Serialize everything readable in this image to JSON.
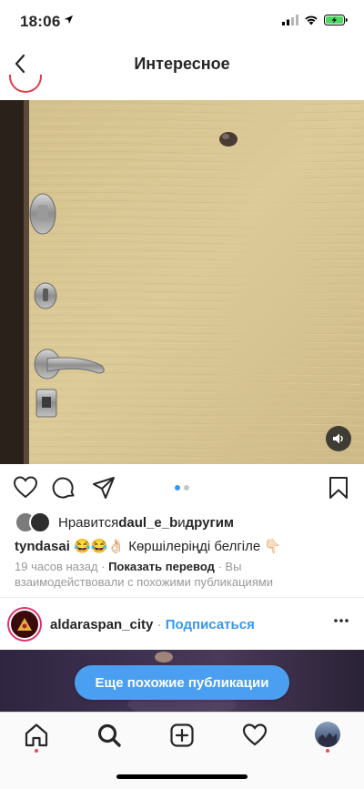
{
  "status": {
    "time": "18:06"
  },
  "nav": {
    "title": "Интересное"
  },
  "post": {
    "likes_prefix": "Нравится ",
    "likes_user": "daul_e_b",
    "likes_and": " и ",
    "likes_others": "другим",
    "caption_user": "tyndasai",
    "caption_text": " 😂😂👌🏻 Көршілеріңді белгіле 👇🏻",
    "time_ago": "19 часов назад",
    "dot_sep": " · ",
    "show_translation": "Показать перевод",
    "meta_tail": " · Вы взаимодействовали с похожими публикациями",
    "carousel_count": 2,
    "carousel_active": 0
  },
  "next_post": {
    "username": "aldaraspan_city",
    "dot": " · ",
    "subscribe": "Подписаться"
  },
  "more_posts_button": "Еще похожие публикации",
  "icons": {
    "back": "chevron-left-icon",
    "sound": "speaker-icon",
    "like": "heart-icon",
    "comment": "comment-icon",
    "share": "send-icon",
    "save": "bookmark-icon",
    "home": "home-icon",
    "search": "search-icon",
    "create": "plus-square-icon",
    "activity": "heart-icon",
    "profile": "avatar-icon"
  },
  "colors": {
    "accent": "#3897f0",
    "pill": "#4a9ff0",
    "notif": "#ed4956",
    "battery": "#4cd964"
  }
}
